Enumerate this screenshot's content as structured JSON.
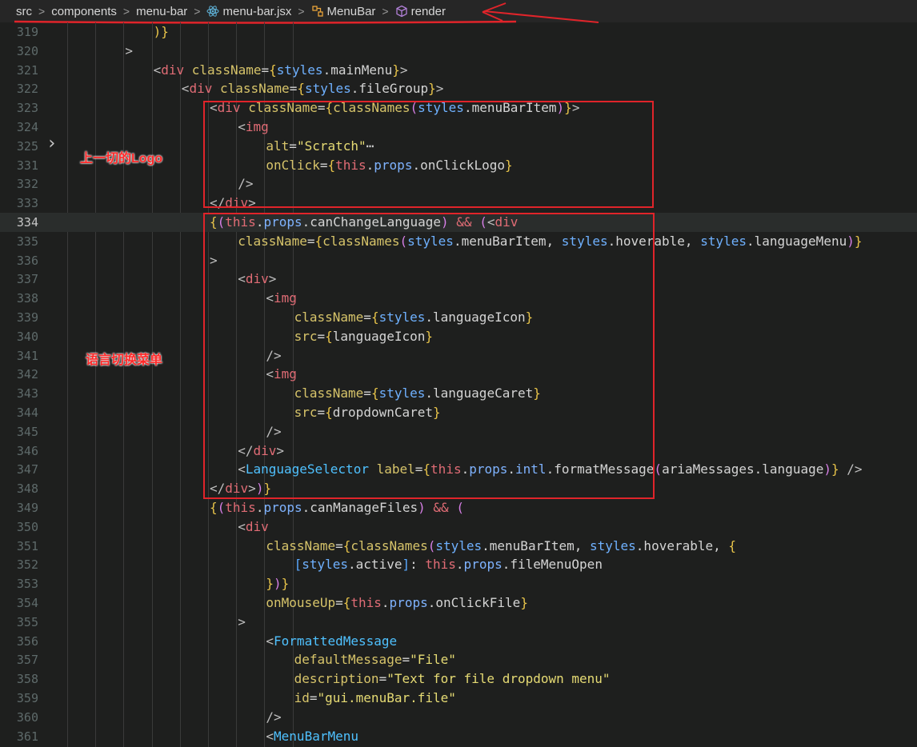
{
  "breadcrumb": {
    "items": [
      "src",
      "components",
      "menu-bar",
      "menu-bar.jsx",
      "MenuBar",
      "render"
    ],
    "separator": ">"
  },
  "annotations": {
    "logo_note": "上一切的Logo",
    "language_note": "语言切换菜单"
  },
  "colors": {
    "annotation": "#e0242a",
    "background": "#1e1f1e"
  },
  "editor": {
    "lines": [
      {
        "n": "319",
        "html": "<span class='b'>)</span><span class='b'>}</span>",
        "indent": 4
      },
      {
        "n": "320",
        "html": "<span class='tp'>&gt;</span>",
        "indent": 3
      },
      {
        "n": "321",
        "html": "<span class='tp'>&lt;</span><span class='t'>div</span> <span class='a'>className</span><span class='op'>=</span><span class='b'>{</span><span class='v'>styles</span><span class='w'>.mainMenu</span><span class='b'>}</span><span class='tp'>&gt;</span>",
        "indent": 4
      },
      {
        "n": "322",
        "html": "<span class='tp'>&lt;</span><span class='t'>div</span> <span class='a'>className</span><span class='op'>=</span><span class='b'>{</span><span class='v'>styles</span><span class='w'>.fileGroup</span><span class='b'>}</span><span class='tp'>&gt;</span>",
        "indent": 5
      },
      {
        "n": "323",
        "html": "<span class='tp'>&lt;</span><span class='t'>div</span> <span class='a'>className</span><span class='op'>=</span><span class='b'>{</span><span class='a'>classNames</span><span class='bp'>(</span><span class='v'>styles</span><span class='w'>.menuBarItem</span><span class='bp'>)</span><span class='b'>}</span><span class='tp'>&gt;</span>",
        "indent": 6
      },
      {
        "n": "324",
        "html": "<span class='tp'>&lt;</span><span class='t'>img</span>",
        "indent": 7
      },
      {
        "n": "325",
        "html": "<span class='a'>alt</span><span class='op'>=</span><span class='s'>\"Scratch\"</span><span class='w'>⋯</span>",
        "indent": 8,
        "fold": true
      },
      {
        "n": "331",
        "html": "<span class='a'>onClick</span><span class='op'>=</span><span class='b'>{</span><span class='kw'>this</span><span class='w'>.</span><span class='pr'>props</span><span class='w'>.onClickLogo</span><span class='b'>}</span>",
        "indent": 8
      },
      {
        "n": "332",
        "html": "<span class='tp'>/&gt;</span>",
        "indent": 7
      },
      {
        "n": "333",
        "html": "<span class='tp'>&lt;/</span><span class='t'>div</span><span class='tp'>&gt;</span>",
        "indent": 6
      },
      {
        "n": "334",
        "html": "<span class='b'>{</span><span class='bp'>(</span><span class='kw'>this</span><span class='w'>.</span><span class='pr'>props</span><span class='w'>.canChangeLanguage</span><span class='bp'>)</span> <span class='kw'>&amp;&amp;</span> <span class='bp'>(</span><span class='tp'>&lt;</span><span class='t'>div</span>",
        "indent": 6,
        "current": true
      },
      {
        "n": "335",
        "html": "<span class='a'>className</span><span class='op'>=</span><span class='b'>{</span><span class='a'>classNames</span><span class='bp'>(</span><span class='v'>styles</span><span class='w'>.menuBarItem, </span><span class='v'>styles</span><span class='w'>.hoverable, </span><span class='v'>styles</span><span class='w'>.languageMenu</span><span class='bp'>)</span><span class='b'>}</span>",
        "indent": 7
      },
      {
        "n": "336",
        "html": "<span class='tp'>&gt;</span>",
        "indent": 6
      },
      {
        "n": "337",
        "html": "<span class='tp'>&lt;</span><span class='t'>div</span><span class='tp'>&gt;</span>",
        "indent": 7
      },
      {
        "n": "338",
        "html": "<span class='tp'>&lt;</span><span class='t'>img</span>",
        "indent": 8
      },
      {
        "n": "339",
        "html": "<span class='a'>className</span><span class='op'>=</span><span class='b'>{</span><span class='v'>styles</span><span class='w'>.languageIcon</span><span class='b'>}</span>",
        "indent": 9
      },
      {
        "n": "340",
        "html": "<span class='a'>src</span><span class='op'>=</span><span class='b'>{</span><span class='w'>languageIcon</span><span class='b'>}</span>",
        "indent": 9
      },
      {
        "n": "341",
        "html": "<span class='tp'>/&gt;</span>",
        "indent": 8
      },
      {
        "n": "342",
        "html": "<span class='tp'>&lt;</span><span class='t'>img</span>",
        "indent": 8
      },
      {
        "n": "343",
        "html": "<span class='a'>className</span><span class='op'>=</span><span class='b'>{</span><span class='v'>styles</span><span class='w'>.languageCaret</span><span class='b'>}</span>",
        "indent": 9
      },
      {
        "n": "344",
        "html": "<span class='a'>src</span><span class='op'>=</span><span class='b'>{</span><span class='w'>dropdownCaret</span><span class='b'>}</span>",
        "indent": 9
      },
      {
        "n": "345",
        "html": "<span class='tp'>/&gt;</span>",
        "indent": 8
      },
      {
        "n": "346",
        "html": "<span class='tp'>&lt;/</span><span class='t'>div</span><span class='tp'>&gt;</span>",
        "indent": 7
      },
      {
        "n": "347",
        "html": "<span class='tp'>&lt;</span><span class='cmp'>LanguageSelector</span> <span class='a'>label</span><span class='op'>=</span><span class='b'>{</span><span class='kw'>this</span><span class='w'>.</span><span class='pr'>props</span><span class='w'>.</span><span class='pr'>intl</span><span class='w'>.formatMessage</span><span class='bp'>(</span><span class='w'>ariaMessages.language</span><span class='bp'>)</span><span class='b'>}</span> <span class='tp'>/&gt;</span>",
        "indent": 7
      },
      {
        "n": "348",
        "html": "<span class='tp'>&lt;/</span><span class='t'>div</span><span class='tp'>&gt;</span><span class='bp'>)</span><span class='b'>}</span>",
        "indent": 6
      },
      {
        "n": "349",
        "html": "<span class='b'>{</span><span class='bp'>(</span><span class='kw'>this</span><span class='w'>.</span><span class='pr'>props</span><span class='w'>.canManageFiles</span><span class='bp'>)</span> <span class='kw'>&amp;&amp;</span> <span class='bp'>(</span>",
        "indent": 6
      },
      {
        "n": "350",
        "html": "<span class='tp'>&lt;</span><span class='t'>div</span>",
        "indent": 7
      },
      {
        "n": "351",
        "html": "<span class='a'>className</span><span class='op'>=</span><span class='b'>{</span><span class='a'>classNames</span><span class='bp'>(</span><span class='v'>styles</span><span class='w'>.menuBarItem, </span><span class='v'>styles</span><span class='w'>.hoverable, </span><span class='b'>{</span>",
        "indent": 8
      },
      {
        "n": "352",
        "html": "<span class='bb'>[</span><span class='v'>styles</span><span class='w'>.active</span><span class='bb'>]</span><span class='w'>: </span><span class='kw'>this</span><span class='w'>.</span><span class='pr'>props</span><span class='w'>.fileMenuOpen</span>",
        "indent": 9
      },
      {
        "n": "353",
        "html": "<span class='b'>}</span><span class='bp'>)</span><span class='b'>}</span>",
        "indent": 8
      },
      {
        "n": "354",
        "html": "<span class='a'>onMouseUp</span><span class='op'>=</span><span class='b'>{</span><span class='kw'>this</span><span class='w'>.</span><span class='pr'>props</span><span class='w'>.onClickFile</span><span class='b'>}</span>",
        "indent": 8
      },
      {
        "n": "355",
        "html": "<span class='tp'>&gt;</span>",
        "indent": 7
      },
      {
        "n": "356",
        "html": "<span class='tp'>&lt;</span><span class='cmp'>FormattedMessage</span>",
        "indent": 8
      },
      {
        "n": "357",
        "html": "<span class='a'>defaultMessage</span><span class='op'>=</span><span class='s'>\"File\"</span>",
        "indent": 9
      },
      {
        "n": "358",
        "html": "<span class='a'>description</span><span class='op'>=</span><span class='s'>\"Text for file dropdown menu\"</span>",
        "indent": 9
      },
      {
        "n": "359",
        "html": "<span class='a'>id</span><span class='op'>=</span><span class='s'>\"gui.menuBar.file\"</span>",
        "indent": 9
      },
      {
        "n": "360",
        "html": "<span class='tp'>/&gt;</span>",
        "indent": 8
      },
      {
        "n": "361",
        "html": "<span class='tp'>&lt;</span><span class='cmp'>MenuBarMenu</span>",
        "indent": 8
      }
    ]
  }
}
